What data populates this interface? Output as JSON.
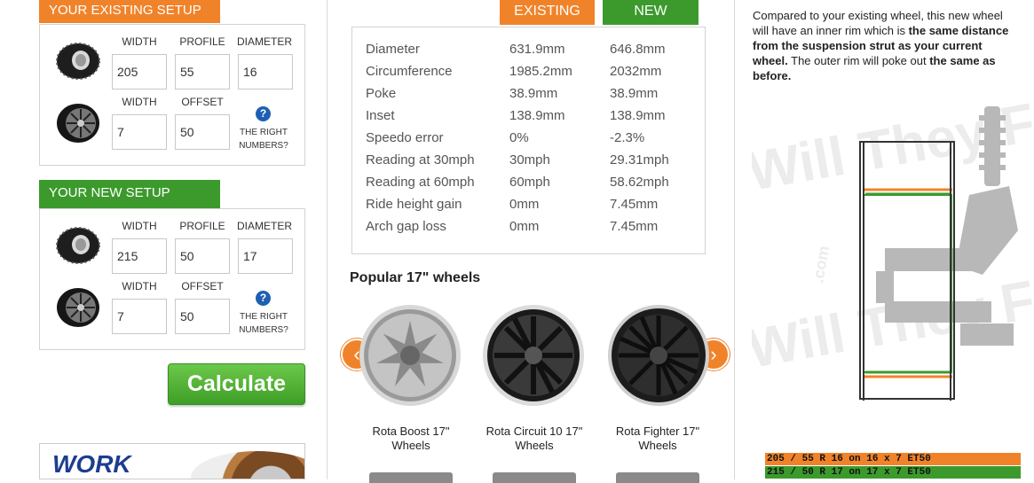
{
  "existing_setup": {
    "header": "YOUR EXISTING SETUP",
    "tyre": {
      "width_label": "WIDTH",
      "profile_label": "PROFILE",
      "diameter_label": "DIAMETER",
      "width": "205",
      "profile": "55",
      "diameter": "16"
    },
    "wheel": {
      "width_label": "WIDTH",
      "offset_label": "OFFSET",
      "width": "7",
      "offset": "50"
    },
    "help_text_1": "THE RIGHT",
    "help_text_2": "NUMBERS?"
  },
  "new_setup": {
    "header": "YOUR NEW SETUP",
    "tyre": {
      "width_label": "WIDTH",
      "profile_label": "PROFILE",
      "diameter_label": "DIAMETER",
      "width": "215",
      "profile": "50",
      "diameter": "17"
    },
    "wheel": {
      "width_label": "WIDTH",
      "offset_label": "OFFSET",
      "width": "7",
      "offset": "50"
    },
    "help_text_1": "THE RIGHT",
    "help_text_2": "NUMBERS?"
  },
  "calculate_label": "Calculate",
  "ad": {
    "brand": "WORK"
  },
  "results": {
    "existing_tab": "EXISTING",
    "new_tab": "NEW",
    "rows": [
      {
        "label": "Diameter",
        "existing": "631.9mm",
        "new": "646.8mm"
      },
      {
        "label": "Circumference",
        "existing": "1985.2mm",
        "new": "2032mm"
      },
      {
        "label": "Poke",
        "existing": "38.9mm",
        "new": "38.9mm"
      },
      {
        "label": "Inset",
        "existing": "138.9mm",
        "new": "138.9mm"
      },
      {
        "label": "Speedo error",
        "existing": "0%",
        "new": "-2.3%"
      },
      {
        "label": "Reading at 30mph",
        "existing": "30mph",
        "new": "29.31mph"
      },
      {
        "label": "Reading at 60mph",
        "existing": "60mph",
        "new": "58.62mph"
      },
      {
        "label": "Ride height gain",
        "existing": "0mm",
        "new": "7.45mm"
      },
      {
        "label": "Arch gap loss",
        "existing": "0mm",
        "new": "7.45mm"
      }
    ]
  },
  "popular": {
    "title": "Popular 17\" wheels",
    "prev_icon": "‹",
    "next_icon": "›",
    "wheels": [
      {
        "name_1": "Rota Boost 17\"",
        "name_2": "Wheels"
      },
      {
        "name_1": "Rota Circuit 10 17\"",
        "name_2": "Wheels"
      },
      {
        "name_1": "Rota Fighter 17\"",
        "name_2": "Wheels"
      }
    ]
  },
  "comparison": {
    "text_1": "Compared to your existing wheel, this new wheel will have an inner rim which is ",
    "bold_1": "the same distance from the suspension strut as your current wheel.",
    "text_2": " The outer rim will poke out ",
    "bold_2": "the same as before."
  },
  "diagram": {
    "watermark": "Will They Fit",
    "watermark_sub": ".com",
    "existing_spec": "205 / 55 R 16 on 16 x 7 ET50",
    "new_spec": "215 / 50 R 17 on 17 x 7 ET50"
  },
  "colors": {
    "orange": "#f0832a",
    "green": "#3c9a2d"
  }
}
